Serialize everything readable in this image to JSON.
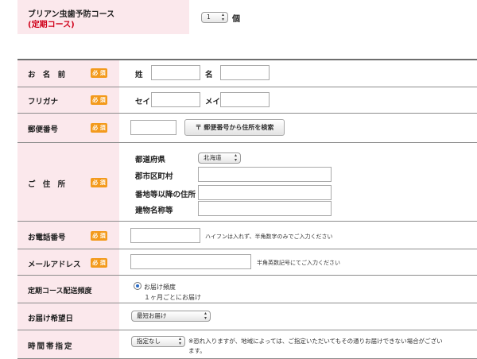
{
  "course": {
    "title": "ブリアン虫歯予防コース",
    "subtitle": "(定期コース)",
    "quantity": "1",
    "unit": "個"
  },
  "badge_required": "必 須",
  "name": {
    "label": "お 名 前",
    "last": "姓",
    "first": "名"
  },
  "furigana": {
    "label": "フリガナ",
    "last": "セイ",
    "first": "メイ"
  },
  "postal": {
    "label": "郵便番号",
    "search_button": "〒 郵便番号から住所を検索"
  },
  "address": {
    "label": "ご 住 所",
    "prefecture": "都道府県",
    "prefecture_value": "北海道",
    "city": "郡市区町村",
    "street": "番地等以降の住所",
    "building": "建物名称等"
  },
  "phone": {
    "label": "お電話番号",
    "hint": "ハイフンは入れず、半角数字のみでご入力ください"
  },
  "email": {
    "label": "メールアドレス",
    "hint": "半角英数記号にてご入力ください"
  },
  "frequency": {
    "label": "定期コース配送頻度",
    "option": "お届け頻度",
    "detail": "１ヶ月ごとにお届け"
  },
  "delivery_date": {
    "label": "お届け希望日",
    "value": "最短お届け"
  },
  "time_slot": {
    "label": "時間帯指定",
    "value": "指定なし",
    "note": "※恐れ入りますが、地域によっては、ご指定いただいてもその通りお届けできない場合がございます。"
  }
}
